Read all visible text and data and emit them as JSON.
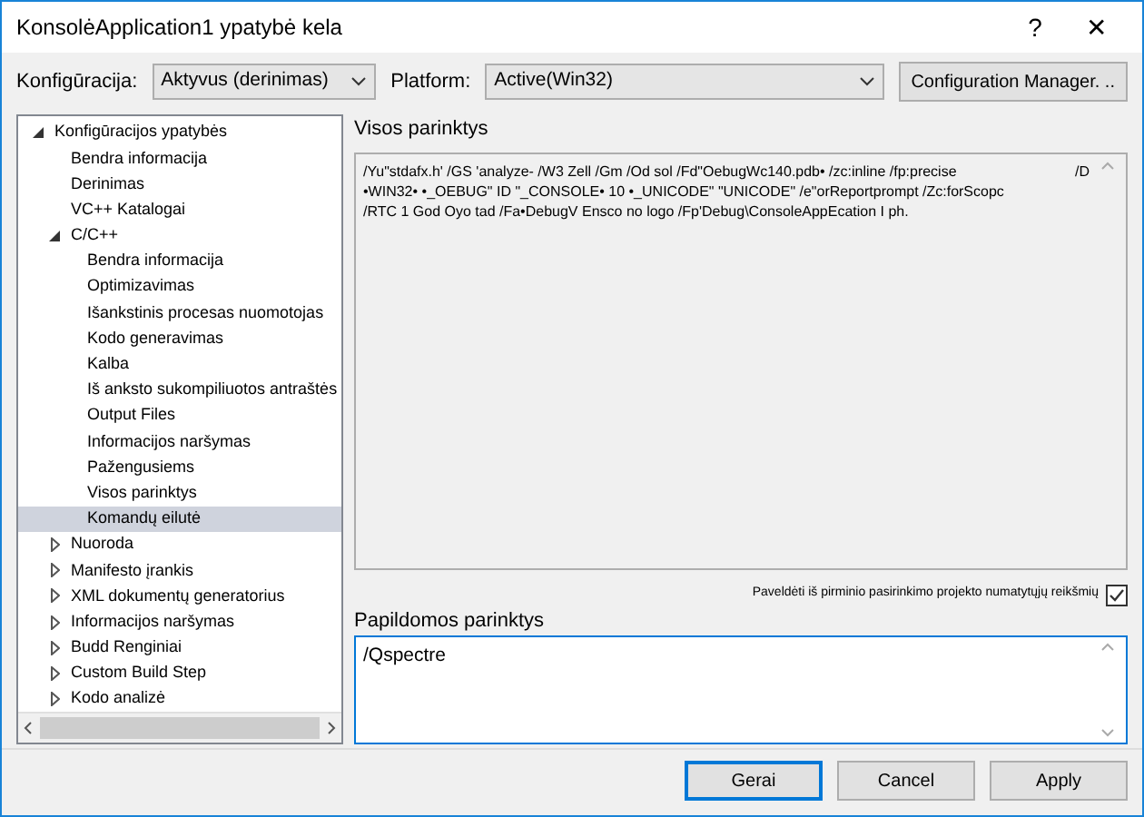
{
  "window": {
    "title": "KonsolėApplication1 ypatybė kela",
    "help": "?",
    "close": "✕"
  },
  "config_bar": {
    "configuration_label": "Konfigūracija:",
    "configuration": "Aktyvus (derinimas)",
    "platform_label": "Platform:",
    "platform": "Active(Win32)",
    "manager_button": "Configuration Manager.   .."
  },
  "tree": [
    {
      "label": "Konfigūracijos ypatybės",
      "expanded": true,
      "selected": false,
      "children": [
        {
          "label": "Bendra informacija",
          "selected": false
        },
        {
          "label": "Derinimas",
          "selected": false
        },
        {
          "label": "VC++ Katalogai",
          "selected": false
        },
        {
          "label": "C/C++",
          "expanded": true,
          "selected": false,
          "children": [
            {
              "label": "Bendra informacija",
              "selected": false
            },
            {
              "label": "Optimizavimas",
              "selected": false
            },
            {
              "label": "Išankstinis procesas nuomotojas",
              "selected": false
            },
            {
              "label": "Kodo generavimas",
              "selected": false
            },
            {
              "label": "Kalba",
              "selected": false
            },
            {
              "label": "Iš anksto sukompiliuotos antraštės",
              "selected": false
            },
            {
              "label": "Output Files",
              "selected": false
            },
            {
              "label": "Informacijos naršymas",
              "selected": false
            },
            {
              "label": "Pažengusiems",
              "selected": false
            },
            {
              "label": "Visos parinktys",
              "selected": false
            },
            {
              "label": "Komandų eilutė",
              "selected": true
            }
          ]
        },
        {
          "label": "Nuoroda",
          "expanded": false,
          "selected": false
        },
        {
          "label": "Manifesto įrankis",
          "expanded": false,
          "selected": false
        },
        {
          "label": "XML dokumentų generatorius",
          "expanded": false,
          "selected": false
        },
        {
          "label": "Informacijos naršymas",
          "expanded": false,
          "selected": false
        },
        {
          "label": "Budd Renginiai",
          "expanded": false,
          "selected": false
        },
        {
          "label": "Custom Build Step",
          "expanded": false,
          "selected": false
        },
        {
          "label": "Kodo analizė",
          "expanded": false,
          "selected": false
        }
      ]
    }
  ],
  "all_options": {
    "label": "Visos parinktys",
    "lines": [
      "/Yu\"stdafx.h' /GS 'analyze- /W3 Zell /Gm /Od sol /Fd\"OebugWc140.pdb• /zc:inline /fp:precise",
      "•WIN32• •_OEBUG\" ID \"_CONSOLE• 10 •_UNICODE\" \"UNICODE\" /e\"orReportprompt /Zc:forScopc",
      "/RTC 1 God Oyo tad /Fa•DebugV Ensco no logo /Fp'Debug\\ConsoleAppEcation I ph."
    ],
    "suffix": "/D"
  },
  "inherit": {
    "label": "Paveldėti iš pirminio pasirinkimo projekto numatytųjų reikšmių",
    "checked": true
  },
  "additional_options": {
    "label": "Papildomos parinktys",
    "value": "/Qspectre"
  },
  "buttons": [
    {
      "label": "Gerai",
      "default": true
    },
    {
      "label": "Cancel",
      "default": false
    },
    {
      "label": "Apply",
      "default": false
    }
  ]
}
